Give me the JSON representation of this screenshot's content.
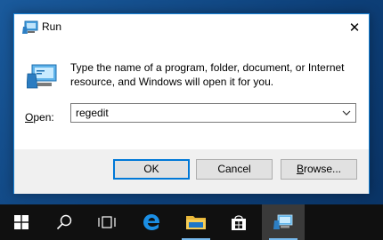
{
  "window": {
    "title": "Run",
    "close_glyph": "✕",
    "icon": "run-icon"
  },
  "dialog": {
    "description": "Type the name of a program, folder, document, or Internet resource, and Windows will open it for you.",
    "open_label_prefix": "O",
    "open_label_rest": "pen:",
    "open_value": "regedit"
  },
  "buttons": {
    "ok": "OK",
    "cancel": "Cancel",
    "browse_prefix": "B",
    "browse_rest": "rowse..."
  },
  "taskbar": {
    "items": [
      "start-icon",
      "search-icon",
      "task-view-icon",
      "edge-icon",
      "file-explorer-icon",
      "store-icon",
      "run-icon"
    ],
    "colors": {
      "accent": "#0078d7",
      "taskbar": "#101010",
      "active": "#3a3a3a"
    }
  }
}
